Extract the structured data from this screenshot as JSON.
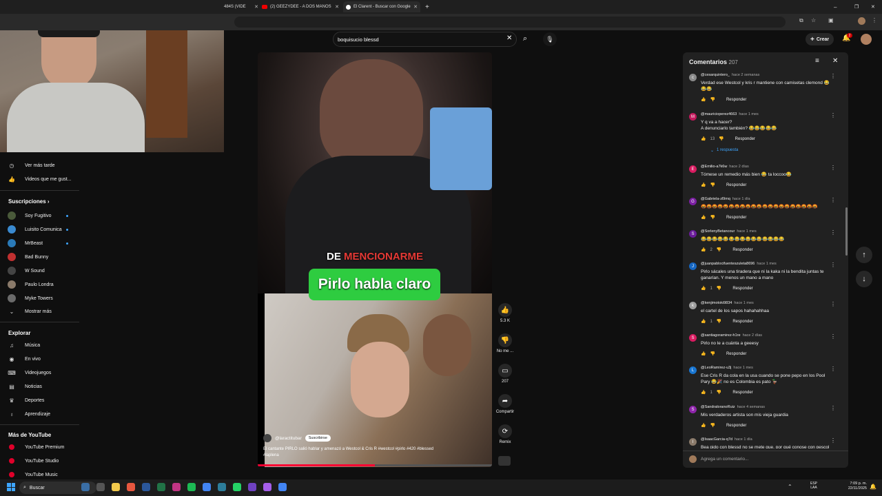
{
  "browser": {
    "tabs": [
      {
        "label": "484S (VIDE",
        "x": 0
      },
      {
        "label": "(2) GEEZYDEE - A DOS MANOS",
        "x": 1
      },
      {
        "label": "El Clarent - Buscar con Google",
        "x": 2
      }
    ],
    "new_tab": "+",
    "window_controls": {
      "min": "–",
      "max": "❐",
      "close": "✕"
    }
  },
  "youtube": {
    "search_value": "boquisucio blessd",
    "create_label": "Crear",
    "notif_count": "2"
  },
  "sidebar": {
    "top_items": [
      {
        "label": "Ver más tarde",
        "icon": "clock-icon"
      },
      {
        "label": "Videos que me gust...",
        "icon": "thumbs-up-icon"
      }
    ],
    "subs_heading": "Suscripciones",
    "subs": [
      {
        "label": "Soy Fugitivo",
        "color": "#4a5a3a",
        "dot": true
      },
      {
        "label": "Luisito Comunica",
        "color": "#3a8ad0",
        "dot": true
      },
      {
        "label": "MrBeast",
        "color": "#2a7ab8",
        "dot": true
      },
      {
        "label": "Bad Bunny",
        "color": "#c03030",
        "dot": false
      },
      {
        "label": "W Sound",
        "color": "#444444",
        "dot": false
      },
      {
        "label": "Paulo Londra",
        "color": "#8a7a6a",
        "dot": false
      },
      {
        "label": "Myke Towers",
        "color": "#6a6a6a",
        "dot": false
      }
    ],
    "show_more": "Mostrar más",
    "explore_heading": "Explorar",
    "explore": [
      {
        "label": "Música",
        "icon": "music-icon"
      },
      {
        "label": "En vivo",
        "icon": "live-icon"
      },
      {
        "label": "Videojuegos",
        "icon": "gamepad-icon"
      },
      {
        "label": "Noticias",
        "icon": "news-icon"
      },
      {
        "label": "Deportes",
        "icon": "trophy-icon"
      },
      {
        "label": "Aprendizaje",
        "icon": "bulb-icon"
      }
    ],
    "more_heading": "Más de YouTube",
    "more": [
      {
        "label": "YouTube Premium"
      },
      {
        "label": "YouTube Studio"
      },
      {
        "label": "YouTube Music"
      }
    ]
  },
  "video": {
    "caption_white": "DE",
    "caption_red": "MENCIONARME",
    "caption_banner": "Pirlo habla claro",
    "channel": "@laractitubar",
    "subscribe": "Suscribirse",
    "description": "El cantante PIRLO salió hablar y amenazó a Westcol & Cris R #westcol #pirlo #420 #blessed #laplena",
    "actions": [
      {
        "label": "5.3 K",
        "icon": "thumbs-up-icon"
      },
      {
        "label": "No me ...",
        "icon": "thumbs-down-icon"
      },
      {
        "label": "207",
        "icon": "comment-icon"
      },
      {
        "label": "Compartir",
        "icon": "share-icon"
      },
      {
        "label": "Remix",
        "icon": "remix-icon"
      }
    ]
  },
  "comments": {
    "title": "Comentarios",
    "count": "207",
    "reply_label": "Responder",
    "add_placeholder": "Agrega un comentario...",
    "items": [
      {
        "user": "@cesarquintero_",
        "time": "hace 2 semanas",
        "text": "Verdad ese Westcol y kris r mantiene con camisetas clemond 😂😂😂",
        "likes": "",
        "avatar": "#8a8a8a",
        "initial": "c"
      },
      {
        "user": "@mauricioperez4663",
        "time": "hace 1 mes",
        "text": "Y q va a hacer?\nA denunciarlo también? 😂😂😂😂😂",
        "likes": "13",
        "avatar": "#c2185b",
        "initial": "M",
        "replies": "1 respuesta"
      },
      {
        "user": "@Emilio-a7k6w",
        "time": "hace 2 días",
        "text": "Tómese un remedio más bien 😂 ta loccoo😂",
        "likes": "",
        "avatar": "#d81b60",
        "initial": "E"
      },
      {
        "user": "@Gabriela-zl9mq",
        "time": "hace 1 día",
        "text": "🤬🤬🤬🤬🤬🤬🤬🤬🤬🤬🤬🤬🤬🤬🤬🤬🤬🤬🤬🤬🤬",
        "likes": "",
        "avatar": "#7b1fa2",
        "initial": "G"
      },
      {
        "user": "@SorlenyBetancour",
        "time": "hace 1 mes",
        "text": "😂😂😂😂😂😂😂😂😂😂😂😂😂😂😂",
        "likes": "2",
        "avatar": "#6a1b9a",
        "initial": "S"
      },
      {
        "user": "@juanpablocifuenteszuleta8696",
        "time": "hace 1 mes",
        "text": "Pirlo sácales una tiradera que ni la kaka ni la bendita juntas te ganarían. Y menos un mano a mano",
        "likes": "1",
        "avatar": "#1565c0",
        "initial": "J"
      },
      {
        "user": "@kenjimotoki9834",
        "time": "hace 1 mes",
        "text": "el cartel de los sapos hahahahhaa",
        "likes": "1",
        "avatar": "#9e9e9e",
        "initial": "k"
      },
      {
        "user": "@santiagoramirez-h1re",
        "time": "hace 2 días",
        "text": "Pirlo no le a cuánta a geeesy",
        "likes": "",
        "avatar": "#d81b60",
        "initial": "S"
      },
      {
        "user": "@LeoRamirez-u3j",
        "time": "hace 1 mes",
        "text": "Ese Cris R da cola en la usa cuando se pone pepo en los Pool Pary 😂🎉 no es Colombia es pato 🦆",
        "likes": "1",
        "avatar": "#1976d2",
        "initial": "L"
      },
      {
        "user": "@SandraloranoRuiz",
        "time": "hace 4 semanas",
        "text": "Mis verdaderos artista son mis vieja guardia",
        "likes": "",
        "avatar": "#8e24aa",
        "initial": "S"
      },
      {
        "user": "@IsaacGarcia-q7d",
        "time": "hace 1 día",
        "text": "Bea pido con blessd no se mete que, por qué conose con pescol",
        "likes": "",
        "avatar": "#8a7a6a",
        "initial": "I"
      }
    ]
  },
  "taskbar": {
    "search": "Buscar",
    "lang": "ESP\nLAA",
    "time": "7:09 p. m.",
    "date": "22/11/2025"
  }
}
